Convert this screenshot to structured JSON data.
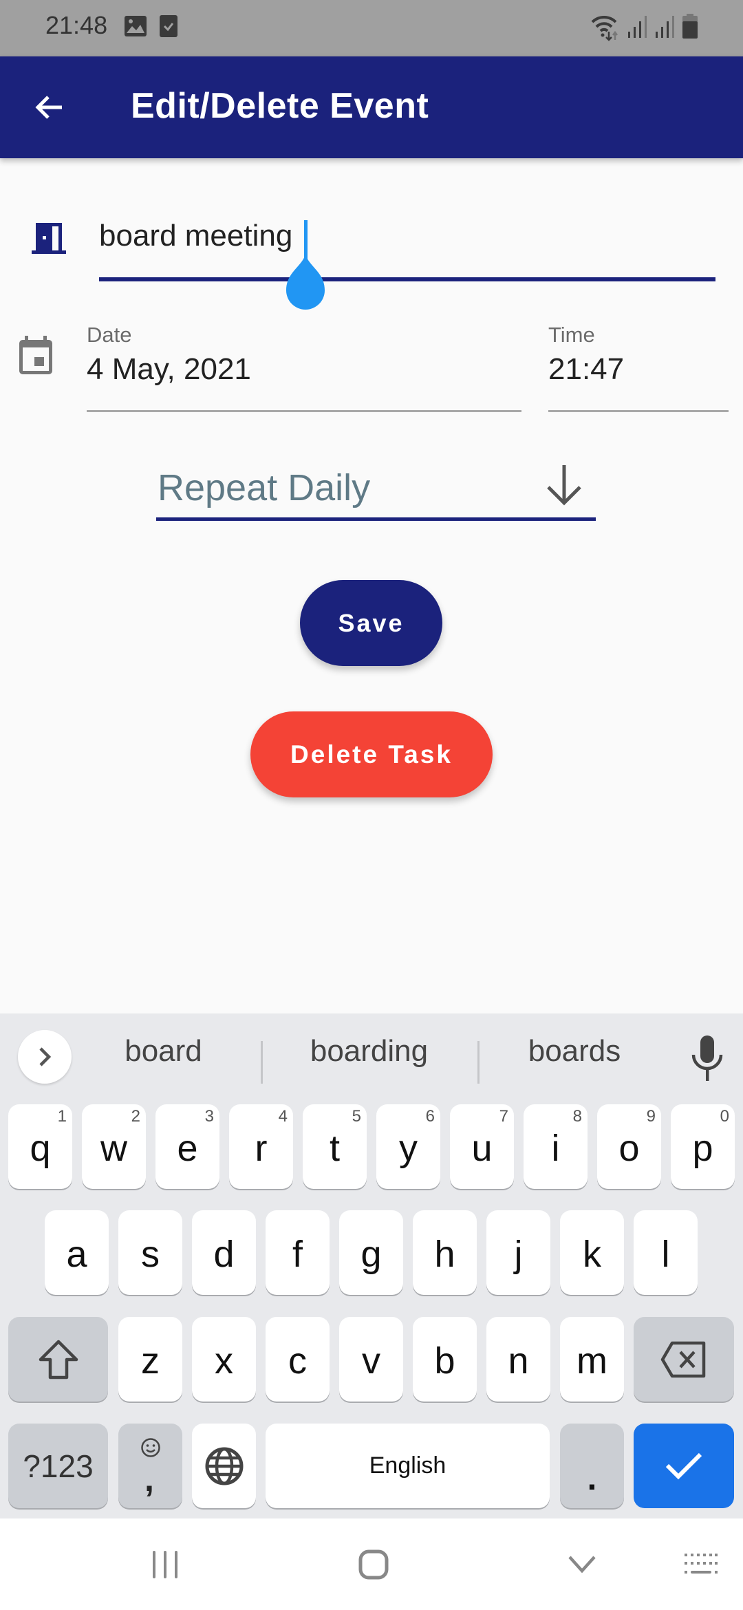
{
  "status_bar": {
    "time": "21:48",
    "left_icons": [
      "gallery-icon",
      "checkbox-icon"
    ],
    "right_icons": [
      "wifi-icon",
      "signal-icon",
      "signal-icon",
      "battery-icon"
    ]
  },
  "app_bar": {
    "title": "Edit/Delete Event",
    "back_icon": "arrow-back-icon",
    "color": "#1b227c"
  },
  "form": {
    "title_input": {
      "icon": "meeting-room-icon",
      "value": "board meeting"
    },
    "date": {
      "icon": "calendar-icon",
      "label": "Date",
      "value": "4 May, 2021"
    },
    "time": {
      "label": "Time",
      "value": "21:47"
    },
    "repeat": {
      "selected": "Repeat Daily",
      "arrow_icon": "arrow-down-icon"
    },
    "save_label": "Save",
    "delete_label": "Delete Task",
    "colors": {
      "primary": "#1b227c",
      "danger": "#f44336",
      "accent": "#2196f3"
    }
  },
  "keyboard": {
    "suggestions": [
      "board",
      "boarding",
      "boards"
    ],
    "row1": [
      {
        "key": "q",
        "hint": "1"
      },
      {
        "key": "w",
        "hint": "2"
      },
      {
        "key": "e",
        "hint": "3"
      },
      {
        "key": "r",
        "hint": "4"
      },
      {
        "key": "t",
        "hint": "5"
      },
      {
        "key": "y",
        "hint": "6"
      },
      {
        "key": "u",
        "hint": "7"
      },
      {
        "key": "i",
        "hint": "8"
      },
      {
        "key": "o",
        "hint": "9"
      },
      {
        "key": "p",
        "hint": "0"
      }
    ],
    "row2": [
      "a",
      "s",
      "d",
      "f",
      "g",
      "h",
      "j",
      "k",
      "l"
    ],
    "row3": [
      "z",
      "x",
      "c",
      "v",
      "b",
      "n",
      "m"
    ],
    "symbols_label": "?123",
    "comma_label": ",",
    "space_label": "English",
    "period_label": ".",
    "enter_color": "#1a73e8"
  },
  "nav_bar": {
    "buttons": [
      "recents-icon",
      "home-icon",
      "back-down-icon",
      "keyboard-switch-icon"
    ]
  }
}
